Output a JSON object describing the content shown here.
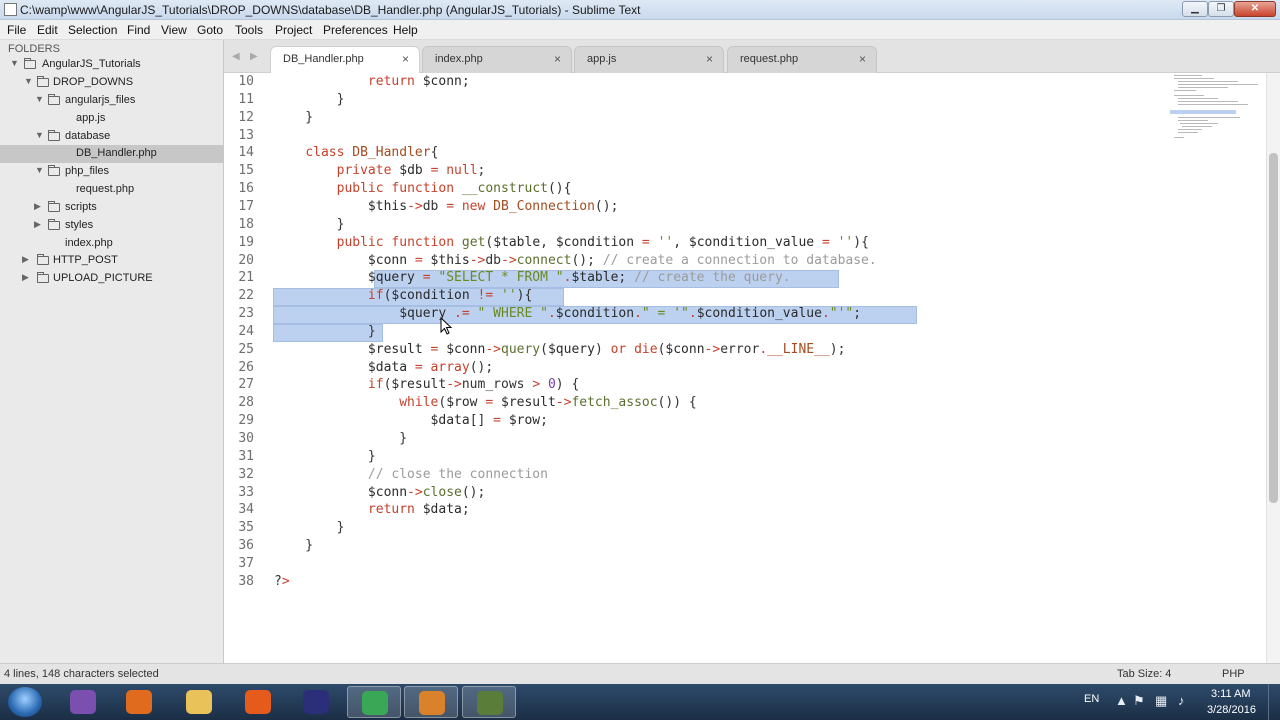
{
  "window": {
    "title": "C:\\wamp\\www\\AngularJS_Tutorials\\DROP_DOWNS\\database\\DB_Handler.php (AngularJS_Tutorials) - Sublime Text",
    "min_glyph": "▁",
    "max_glyph": "❐",
    "close_glyph": "✕"
  },
  "menu": {
    "items": [
      "File",
      "Edit",
      "Selection",
      "Find",
      "View",
      "Goto",
      "Tools",
      "Project",
      "Preferences",
      "Help"
    ]
  },
  "sidebar": {
    "title": "FOLDERS",
    "items": [
      {
        "label": "AngularJS_Tutorials",
        "type": "folder",
        "expanded": true
      },
      {
        "label": "DROP_DOWNS",
        "type": "folder",
        "expanded": true
      },
      {
        "label": "angularjs_files",
        "type": "folder",
        "expanded": true
      },
      {
        "label": "app.js",
        "type": "file"
      },
      {
        "label": "database",
        "type": "folder",
        "expanded": true
      },
      {
        "label": "DB_Handler.php",
        "type": "file",
        "selected": true
      },
      {
        "label": "php_files",
        "type": "folder",
        "expanded": true
      },
      {
        "label": "request.php",
        "type": "file"
      },
      {
        "label": "scripts",
        "type": "folder",
        "expanded": false
      },
      {
        "label": "styles",
        "type": "folder",
        "expanded": false
      },
      {
        "label": "index.php",
        "type": "file"
      },
      {
        "label": "HTTP_POST",
        "type": "folder",
        "expanded": false
      },
      {
        "label": "UPLOAD_PICTURE",
        "type": "folder",
        "expanded": false
      }
    ]
  },
  "tabs": {
    "nav_left": "◀",
    "nav_right": "▶",
    "close_glyph": "×",
    "items": [
      {
        "label": "DB_Handler.php",
        "active": true
      },
      {
        "label": "index.php",
        "active": false
      },
      {
        "label": "app.js",
        "active": false
      },
      {
        "label": "request.php",
        "active": false
      }
    ]
  },
  "editor": {
    "lines": [
      {
        "num": "10",
        "code": "            return $conn;"
      },
      {
        "num": "11",
        "code": "        }"
      },
      {
        "num": "12",
        "code": "    }"
      },
      {
        "num": "13",
        "code": ""
      },
      {
        "num": "14",
        "code": "    class DB_Handler{"
      },
      {
        "num": "15",
        "code": "        private $db = null;"
      },
      {
        "num": "16",
        "code": "        public function __construct(){"
      },
      {
        "num": "17",
        "code": "            $this->db = new DB_Connection();"
      },
      {
        "num": "18",
        "code": "        }"
      },
      {
        "num": "19",
        "code": "        public function get($table, $condition = '', $condition_value = ''){"
      },
      {
        "num": "20",
        "code": "            $conn = $this->db->connect(); // create a connection to database."
      },
      {
        "num": "21",
        "code": "            $query = \"SELECT * FROM \".$table; // create the query."
      },
      {
        "num": "22",
        "code": "            if($condition != ''){"
      },
      {
        "num": "23",
        "code": "                $query .= \" WHERE \".$condition.\" = '\".$condition_value.\"'\";"
      },
      {
        "num": "24",
        "code": "            }"
      },
      {
        "num": "25",
        "code": "            $result = $conn->query($query) or die($conn->error.__LINE__);"
      },
      {
        "num": "26",
        "code": "            $data = array();"
      },
      {
        "num": "27",
        "code": "            if($result->num_rows > 0) {"
      },
      {
        "num": "28",
        "code": "                while($row = $result->fetch_assoc()) {"
      },
      {
        "num": "29",
        "code": "                    $data[] = $row;"
      },
      {
        "num": "30",
        "code": "                }"
      },
      {
        "num": "31",
        "code": "            }"
      },
      {
        "num": "32",
        "code": "            // close the connection"
      },
      {
        "num": "33",
        "code": "            $conn->close();"
      },
      {
        "num": "34",
        "code": "            return $data;"
      },
      {
        "num": "35",
        "code": "        }"
      },
      {
        "num": "36",
        "code": "    }"
      },
      {
        "num": "37",
        "code": ""
      },
      {
        "num": "38",
        "code": "?>"
      }
    ]
  },
  "status": {
    "selection": "4 lines, 148 characters selected",
    "tab_size": "Tab Size: 4",
    "syntax": "PHP"
  },
  "taskbar": {
    "apps": [
      {
        "name": "media-player-icon",
        "color": "#7a4fb0",
        "active": false
      },
      {
        "name": "slideshow-icon",
        "color": "#e06a1d",
        "active": false
      },
      {
        "name": "file-explorer-icon",
        "color": "#e9c35a",
        "active": false
      },
      {
        "name": "firefox-icon",
        "color": "#e55b1c",
        "active": false
      },
      {
        "name": "eclipse-icon",
        "color": "#2b2e78",
        "active": false
      },
      {
        "name": "chrome-icon",
        "color": "#3aa757",
        "active": true
      },
      {
        "name": "sublime-text-icon",
        "color": "#d9822b",
        "active": true
      },
      {
        "name": "tools-app-icon",
        "color": "#5a7d3a",
        "active": true
      }
    ],
    "lang": "EN",
    "time": "3:11 AM",
    "date": "3/28/2016"
  },
  "colors": {
    "selection": "#bcd0ef",
    "keyword": "#c6412b",
    "string": "#6b8a1e",
    "comment": "#9b9b9b"
  }
}
